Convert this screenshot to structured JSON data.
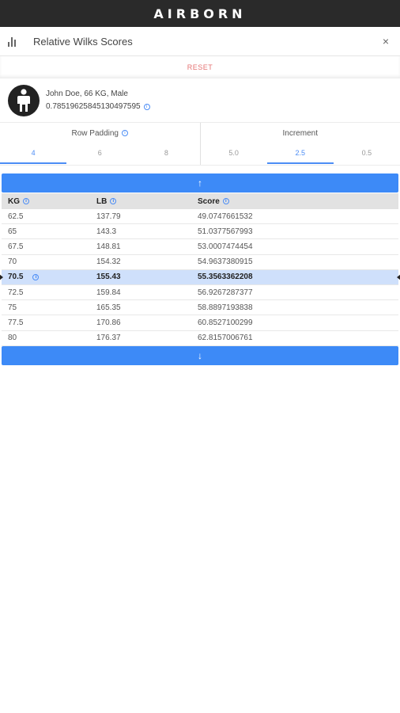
{
  "app": {
    "brand": "AIRBORN"
  },
  "header": {
    "title": "Relative Wilks Scores",
    "close_glyph": "×",
    "icon": "bar-chart-icon"
  },
  "reset_label": "RESET",
  "profile": {
    "name_line": "John Doe, 66 KG, Male",
    "coefficient": "0.7851962584513049759​5",
    "avatar_icon": "person-icon"
  },
  "options": {
    "row_padding": {
      "title": "Row Padding",
      "values": [
        "4",
        "6",
        "8"
      ],
      "selected": "4"
    },
    "increment": {
      "title": "Increment",
      "values": [
        "5.0",
        "2.5",
        "0.5"
      ],
      "selected": "2.5"
    }
  },
  "table": {
    "headers": {
      "kg": "KG",
      "lb": "LB",
      "score": "Score"
    },
    "rows": [
      {
        "kg": "62.5",
        "lb": "137.79",
        "score": "49.0747661532"
      },
      {
        "kg": "65",
        "lb": "143.3",
        "score": "51.0377567993"
      },
      {
        "kg": "67.5",
        "lb": "148.81",
        "score": "53.0007474454"
      },
      {
        "kg": "70",
        "lb": "154.32",
        "score": "54.9637380915"
      },
      {
        "kg": "70.5",
        "lb": "155.43",
        "score": "55.3563362208",
        "selected": true
      },
      {
        "kg": "72.5",
        "lb": "159.84",
        "score": "56.9267287377"
      },
      {
        "kg": "75",
        "lb": "165.35",
        "score": "58.8897193838"
      },
      {
        "kg": "77.5",
        "lb": "170.86",
        "score": "60.8527100299"
      },
      {
        "kg": "80",
        "lb": "176.37",
        "score": "62.8157006761"
      }
    ]
  },
  "buttons": {
    "up_glyph": "↑",
    "down_glyph": "↓"
  },
  "colors": {
    "accent": "#3d8af7",
    "reset": "#e57373",
    "selected_row": "#cfe0fb",
    "topbar": "#2a2a2a"
  }
}
